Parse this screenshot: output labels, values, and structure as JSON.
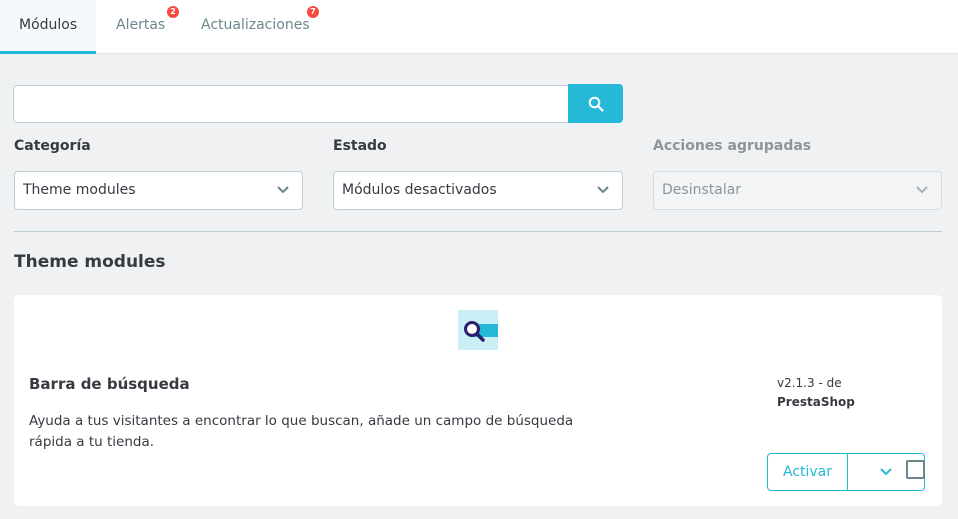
{
  "tabs": [
    {
      "label": "Módulos",
      "active": true
    },
    {
      "label": "Alertas",
      "badge": "2"
    },
    {
      "label": "Actualizaciones",
      "badge": "7"
    }
  ],
  "search": {
    "value": "",
    "placeholder": "",
    "icon": "search-icon"
  },
  "filters": {
    "category": {
      "label": "Categoría",
      "selected": "Theme modules"
    },
    "status": {
      "label": "Estado",
      "selected": "Módulos desactivados"
    },
    "bulk": {
      "label": "Acciones agrupadas",
      "selected": "Desinstalar",
      "disabled": true
    }
  },
  "section": {
    "title": "Theme modules"
  },
  "module": {
    "name": "Barra de búsqueda",
    "description": "Ayuda a tus visitantes a encontrar lo que buscan, añade un campo de búsqueda rápida a tu tienda.",
    "version": "v2.1.3 - de",
    "author": "PrestaShop",
    "action_label": "Activar",
    "icon": "search-bar-module-icon"
  },
  "colors": {
    "accent": "#25b9d7",
    "badge": "#f54c3e",
    "text": "#363a41",
    "background": "#eff1f2"
  }
}
